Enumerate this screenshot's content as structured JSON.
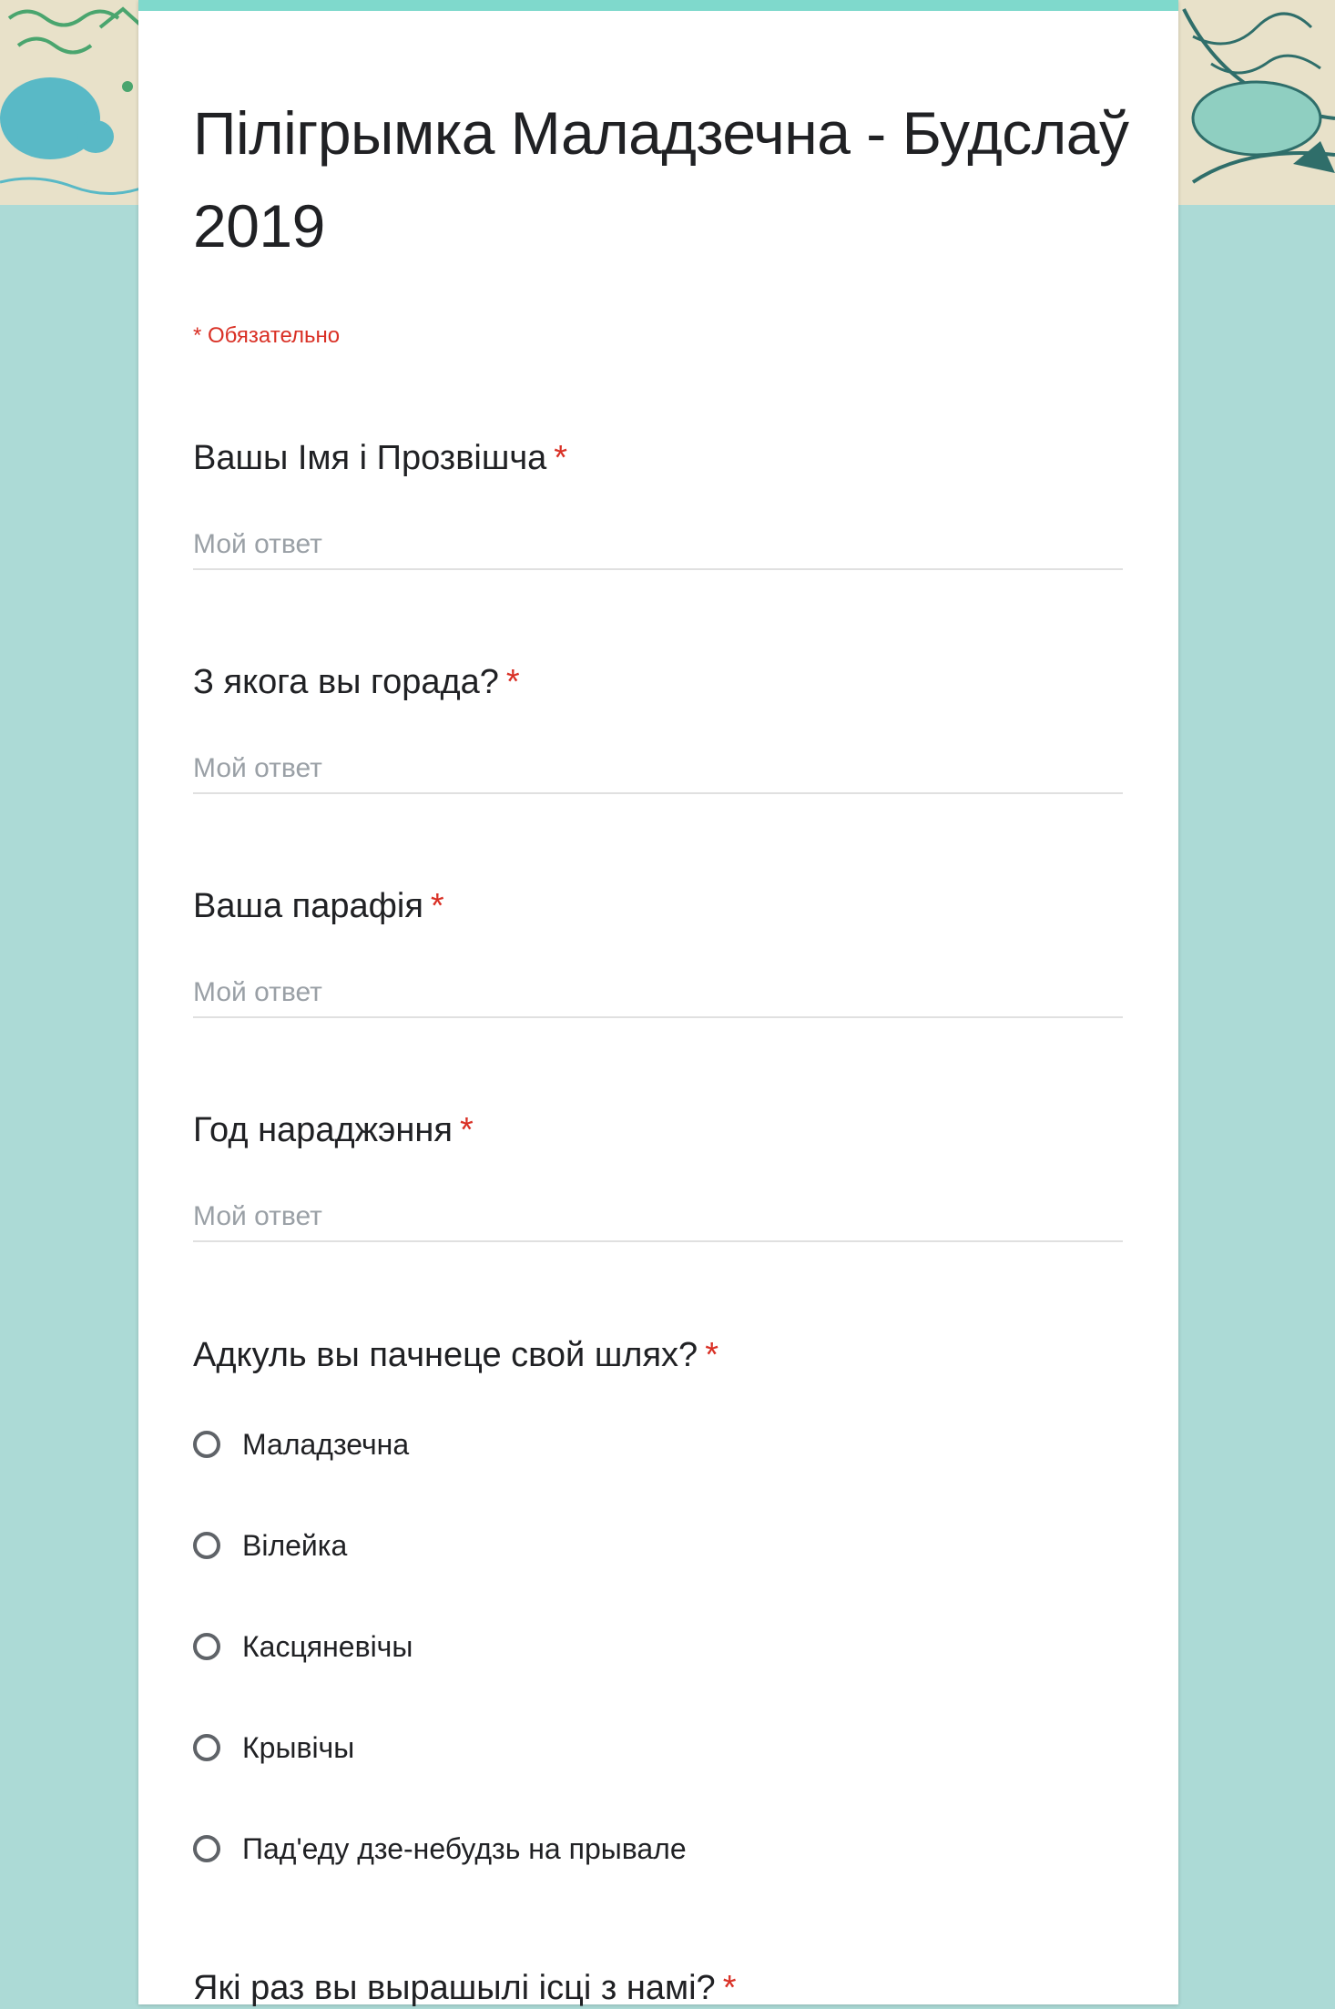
{
  "theme": {
    "page_background": "#acdad6",
    "header_background": "#e8e1c9",
    "accent": "#7fd9cc",
    "required_color": "#d93025"
  },
  "form": {
    "title": "Пілігрымка Маладзечна - Будслаў 2019",
    "required_note": "* Обязательно",
    "required_star": "*",
    "answer_placeholder": "Мой ответ"
  },
  "questions": [
    {
      "label": "Вашы Імя і Прозвішча",
      "type": "text"
    },
    {
      "label": "З якога вы горада?",
      "type": "text"
    },
    {
      "label": "Ваша парафія",
      "type": "text"
    },
    {
      "label": "Год нараджэння",
      "type": "text"
    },
    {
      "label": "Адкуль вы пачнеце свой шлях?",
      "type": "radio",
      "options": [
        "Маладзечна",
        "Вілейка",
        "Касцяневічы",
        "Крывічы",
        "Пад'еду дзе-небудзь на прывале"
      ]
    },
    {
      "label": "Які раз вы вырашылі ісці з намі?",
      "type": "radio"
    }
  ]
}
